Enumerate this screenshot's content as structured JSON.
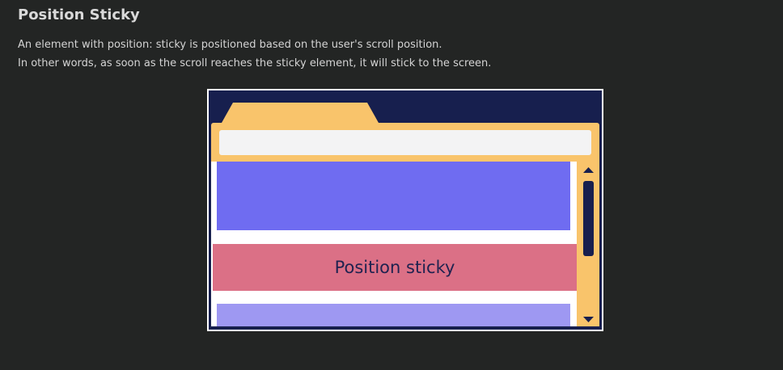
{
  "article": {
    "title": "Position Sticky",
    "description_line1": "An element with position: sticky is positioned based on the user's scroll position.",
    "description_line2": "In other words, as soon as the scroll reaches the sticky element, it will stick to the screen."
  },
  "illustration": {
    "sticky_label": "Position sticky",
    "colors": {
      "background": "#232524",
      "frame_navy": "#171f4e",
      "folder_yellow": "#f9c46b",
      "header_bar": "#f3f3f4",
      "block_blue": "#6f6cf1",
      "block_sticky": "#db7086",
      "block_light": "#9e98f2",
      "scrollbar_track": "#f9c46b",
      "scrollbar_thumb": "#171f4e"
    },
    "icons": [
      "arrow-up-icon",
      "arrow-down-icon"
    ]
  }
}
